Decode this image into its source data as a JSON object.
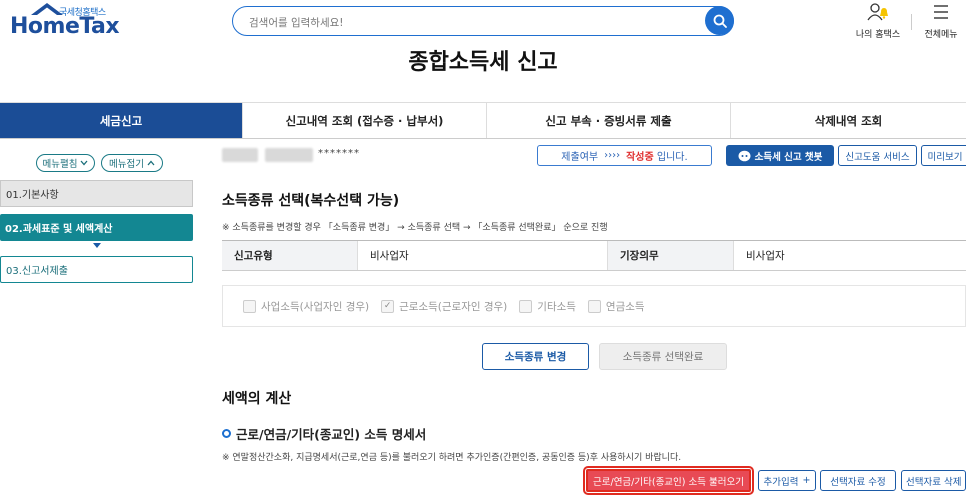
{
  "header": {
    "logo_sub": "국세청홈택스",
    "logo_main": "HomeTax",
    "search_placeholder": "검색어를 입력하세요!",
    "my_hometax_label": "나의 홈택스",
    "all_menu_label": "전체메뉴"
  },
  "page_title": "종합소득세 신고",
  "tabs": [
    {
      "label": "세금신고",
      "active": true
    },
    {
      "label": "신고내역 조회 (접수증 · 납부서)",
      "active": false
    },
    {
      "label": "신고 부속 · 증빙서류 제출",
      "active": false
    },
    {
      "label": "삭제내역 조회",
      "active": false
    }
  ],
  "sidebar": {
    "expand_label": "메뉴펼침",
    "collapse_label": "메뉴접기",
    "items": [
      {
        "label": "01.기본사항"
      },
      {
        "label": "02.과세표준 및 세액계산"
      },
      {
        "label": "03.신고서제출"
      }
    ]
  },
  "user": {
    "masked_id": "*******"
  },
  "status": {
    "prefix": "제출여부",
    "arrows": "››››",
    "state": "작성중",
    "suffix": "입니다."
  },
  "buttons": {
    "chatbot": "소득세 신고 챗봇",
    "help_service": "신고도움 서비스",
    "preview": "미리보기",
    "change_type": "소득종류 변경",
    "complete_type": "소득종류 선택완료",
    "load_statement": "근로/연금/기타(종교인) 소득 불러오기",
    "add_input": "추가입력",
    "add_plus": "+",
    "edit_selected": "선택자료 수정",
    "delete_selected": "선택자료 삭제"
  },
  "income_select": {
    "title": "소득종류 선택(복수선택 가능)",
    "note": "※ 소득종류를 변경할 경우 「소득종류 변경」 → 소득종류 선택 → 「소득종류 선택완료」 순으로 진행",
    "table": {
      "headers": [
        "신고유형",
        "기장의무"
      ],
      "values": [
        "비사업자",
        "비사업자"
      ]
    },
    "checkboxes": [
      {
        "label": "사업소득(사업자인 경우)",
        "checked": false
      },
      {
        "label": "근로소득(근로자인 경우)",
        "checked": true
      },
      {
        "label": "기타소득",
        "checked": false
      },
      {
        "label": "연금소득",
        "checked": false
      }
    ]
  },
  "tax_calc": {
    "title": "세액의 계산",
    "subtitle": "근로/연금/기타(종교인) 소득 명세서",
    "note": "※ 연말정산간소화, 지급명세서(근로,연금 등)를 불러오기 하려면 추가인증(간편인증, 공동인증 등)후 사용하시기 바랍니다."
  },
  "colors": {
    "brand_blue": "#1b4d96",
    "teal": "#138792",
    "accent_red": "#e84a55",
    "status_red": "#e03030"
  }
}
